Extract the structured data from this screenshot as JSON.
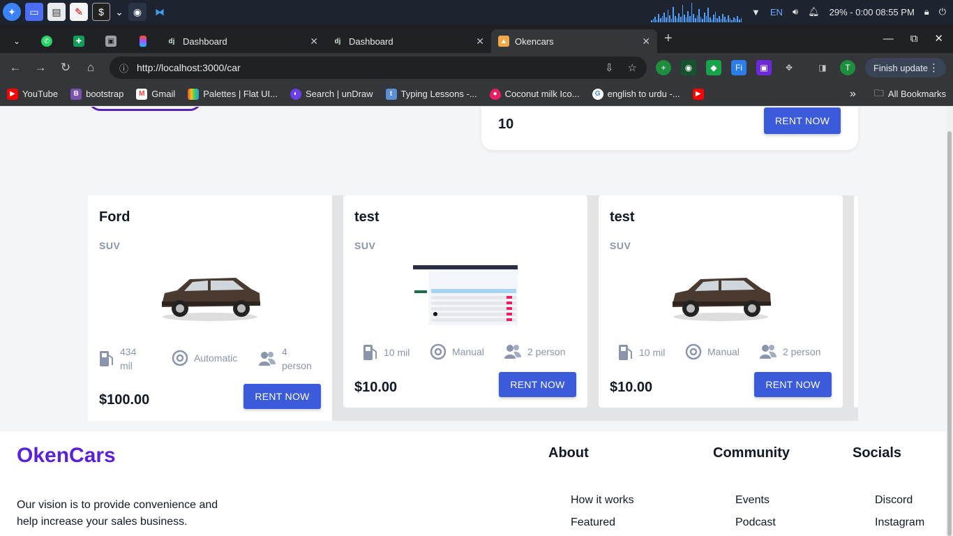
{
  "taskbar": {
    "language": "EN",
    "battery_clock": "29% - 0:00 08:55 PM"
  },
  "tabs": [
    {
      "label": "Dashboard"
    },
    {
      "label": "Dashboard"
    },
    {
      "label": "Okencars"
    }
  ],
  "toolbar": {
    "url": "http://localhost:3000/car",
    "finish_update": "Finish update",
    "profile_initial": "T"
  },
  "bookmarks": [
    {
      "label": "YouTube",
      "color": "#ff0000"
    },
    {
      "label": "bootstrap",
      "color": "#7952b3"
    },
    {
      "label": "Gmail",
      "color": "#ea4335"
    },
    {
      "label": "Palettes | Flat UI...",
      "color": "#e67e22"
    },
    {
      "label": "Search | unDraw",
      "color": "#6c3fe8"
    },
    {
      "label": "Typing Lessons -...",
      "color": "#5a8fd6"
    },
    {
      "label": "Coconut milk Ico...",
      "color": "#e91e63"
    },
    {
      "label": "english to urdu -...",
      "color": "#4285f4"
    }
  ],
  "all_bookmarks": "All Bookmarks",
  "top_card": {
    "value": "10",
    "rent_label": "RENT NOW"
  },
  "cars": [
    {
      "name": "Ford",
      "type": "SUV",
      "mileage": "434 mil",
      "mileage_l1": "434",
      "mileage_l2": "mil",
      "transmission": "Automatic",
      "capacity_l1": "4",
      "capacity_l2": "person",
      "price": "$100.00",
      "rent_label": "RENT NOW"
    },
    {
      "name": "test",
      "type": "SUV",
      "mileage": "10 mil",
      "transmission": "Manual",
      "capacity": "2 person",
      "price": "$10.00",
      "rent_label": "RENT NOW"
    },
    {
      "name": "test",
      "type": "SUV",
      "mileage": "10 mil",
      "transmission": "Manual",
      "capacity": "2 person",
      "price": "$10.00",
      "rent_label": "RENT NOW"
    }
  ],
  "footer": {
    "brand": "OkenCars",
    "vision": "Our vision is to provide convenience and help increase your sales business.",
    "about": {
      "title": "About",
      "links": [
        "How it works",
        "Featured"
      ]
    },
    "community": {
      "title": "Community",
      "links": [
        "Events",
        "Podcast"
      ]
    },
    "socials": {
      "title": "Socials",
      "links": [
        "Discord",
        "Instagram"
      ]
    }
  },
  "colors": {
    "brand": "#5b21d6",
    "button": "#3b5bdb",
    "muted": "#8a94ad"
  }
}
